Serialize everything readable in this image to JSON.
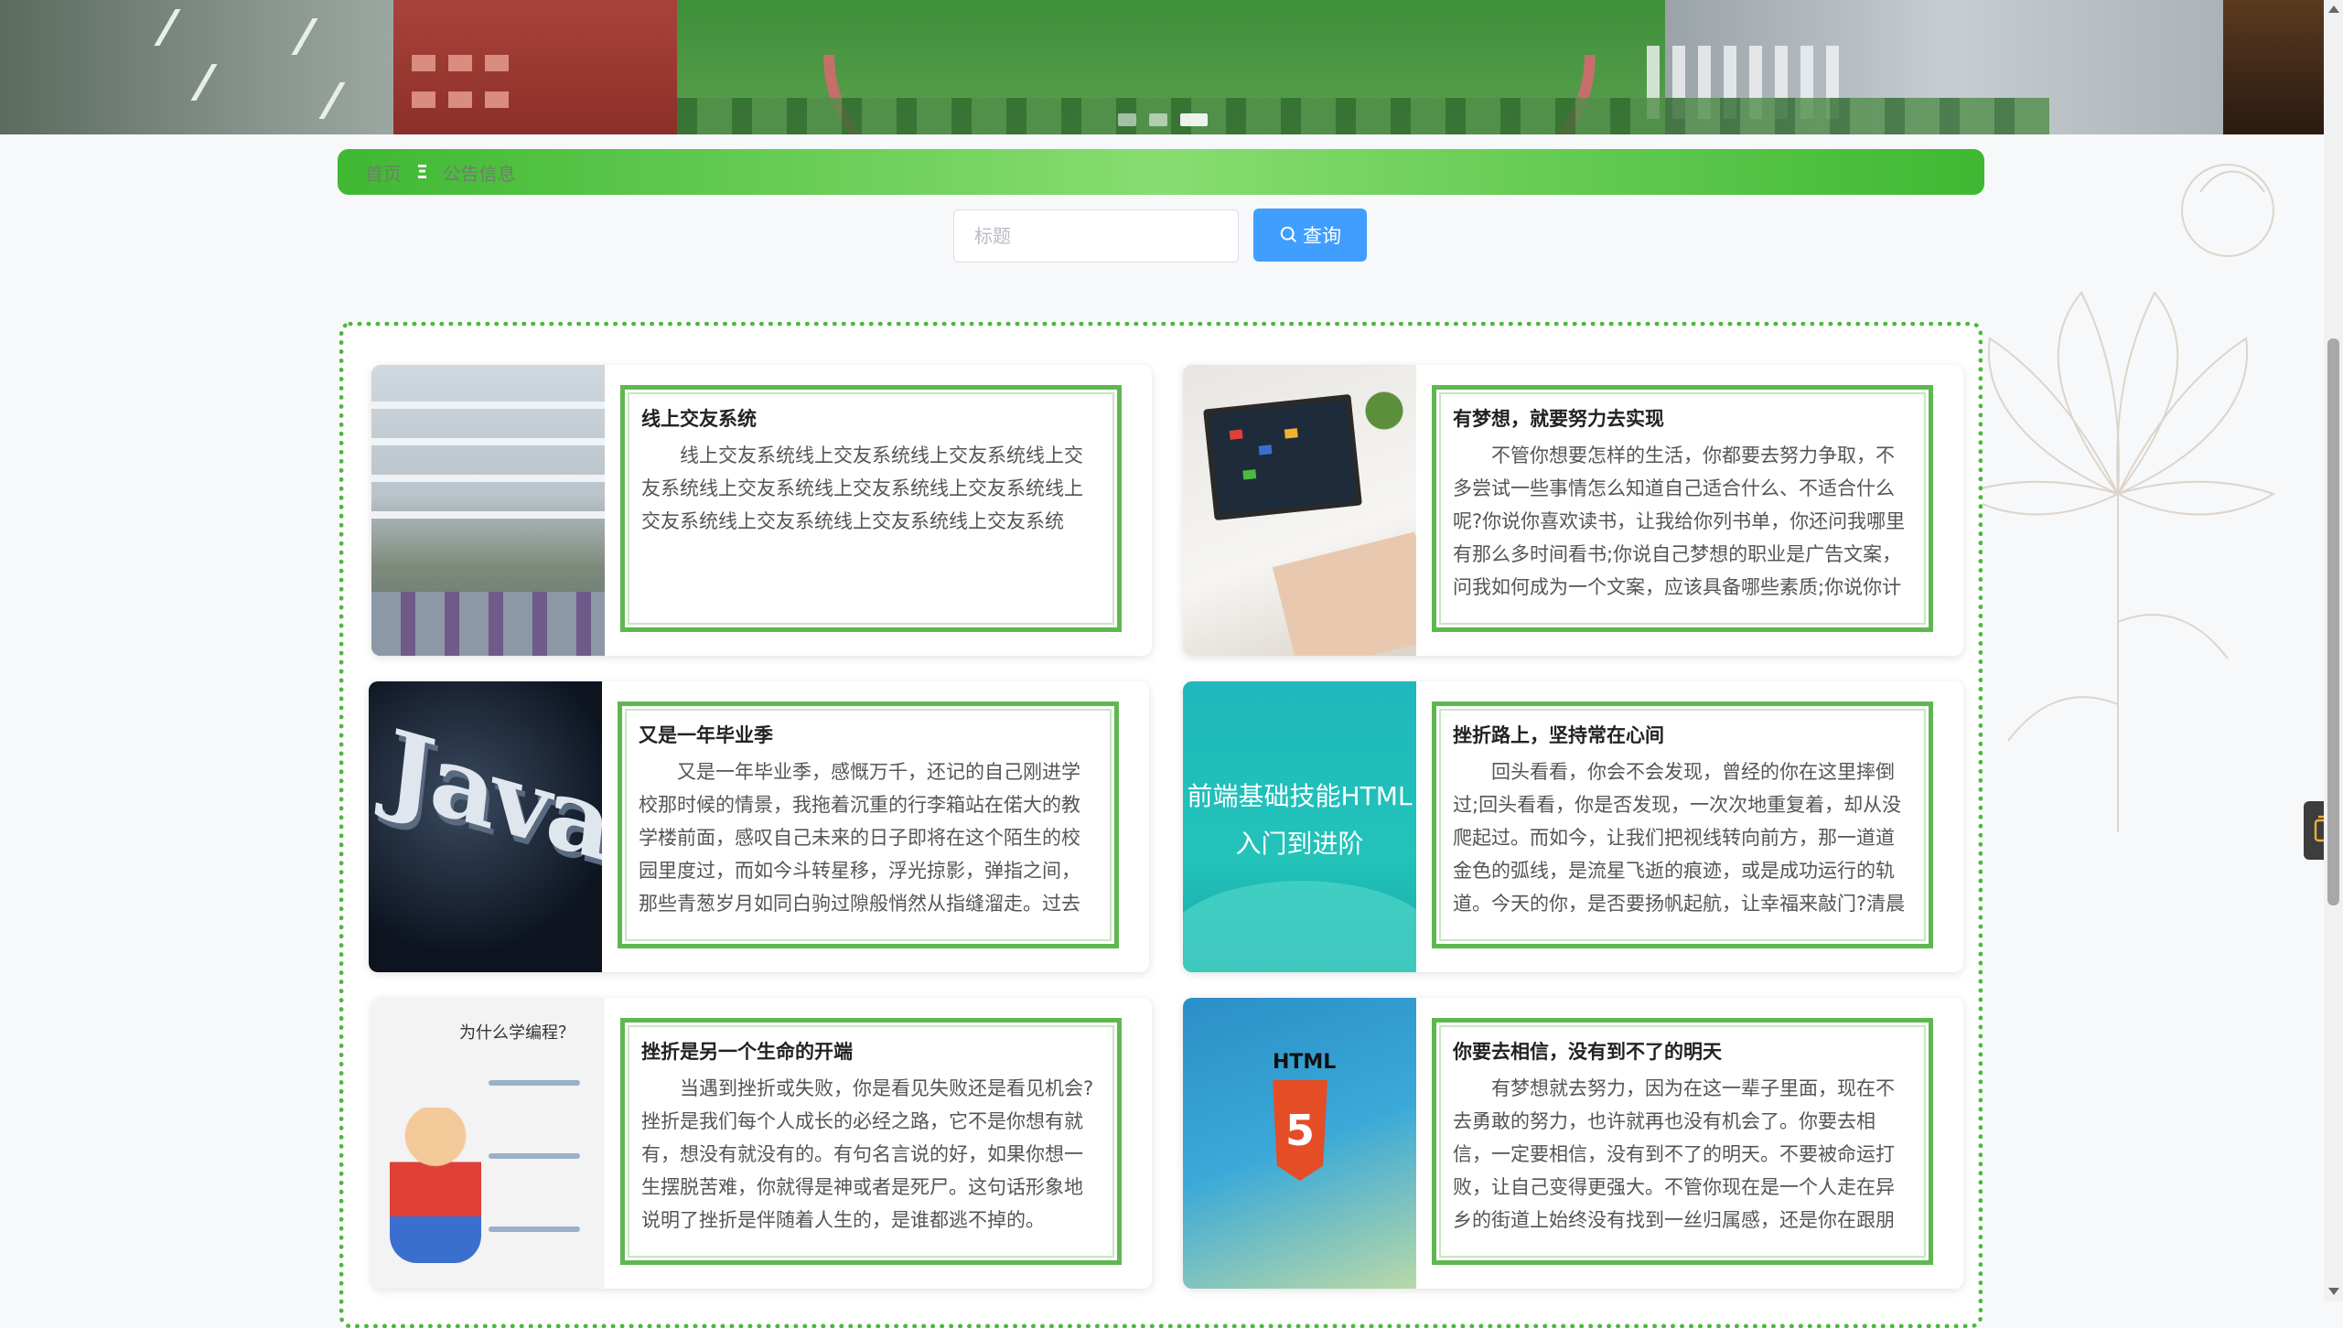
{
  "breadcrumb": {
    "home": "首页",
    "separator": "Ξ",
    "current": "公告信息"
  },
  "search": {
    "placeholder": "标题",
    "button_label": "查询"
  },
  "banner": {
    "slides": 3,
    "active_slide": 3
  },
  "colors": {
    "green": "#4cb840",
    "blue": "#409eff"
  },
  "thumb_texts": {
    "java": "Java",
    "html_line1": "前端基础技能HTML",
    "html_line2": "入门到进阶",
    "cartoon_heading": "为什么学编程？",
    "html5_label": "HTML",
    "html5_glyph": "5"
  },
  "notices": [
    {
      "title": "线上交友系统",
      "content": "线上交友系统线上交友系统线上交友系统线上交友系统线上交友系统线上交友系统线上交友系统线上交友系统线上交友系统线上交友系统线上交友系统",
      "image": "campus-building"
    },
    {
      "title": "有梦想，就要努力去实现",
      "content": "不管你想要怎样的生活，你都要去努力争取，不多尝试一些事情怎么知道自己适合什么、不适合什么呢?你说你喜欢读书，让我给你列书单，你还问我哪里有那么多时间看书;你说自己梦想的职业是广告文案，问我如何成为一个文案，应该具备哪些素质;你说你计",
      "image": "laptop-desk"
    },
    {
      "title": "又是一年毕业季",
      "content": "又是一年毕业季，感慨万千，还记的自己刚进学校那时候的情景，我拖着沉重的行李箱站在偌大的教学楼前面，感叹自己未来的日子即将在这个陌生的校园里度过，而如今斗转星移，浮光掠影，弹指之间，那些青葱岁月如同白驹过隙般悄然从指缝溜走。过去",
      "image": "java"
    },
    {
      "title": "挫折路上，坚持常在心间",
      "content": "回头看看，你会不会发现，曾经的你在这里摔倒过;回头看看，你是否发现，一次次地重复着，却从没爬起过。而如今，让我们把视线转向前方，那一道道金色的弧线，是流星飞逝的痕迹，或是成功运行的轨道。今天的你，是否要扬帆起航，让幸福来敲门?清晨",
      "image": "html-course"
    },
    {
      "title": "挫折是另一个生命的开端",
      "content": "当遇到挫折或失败，你是看见失败还是看见机会?挫折是我们每个人成长的必经之路，它不是你想有就有，想没有就没有的。有句名言说的好，如果你想一生摆脱苦难，你就得是神或者是死尸。这句话形象地说明了挫折是伴随着人生的，是谁都逃不掉的。",
      "image": "cartoon-programming"
    },
    {
      "title": "你要去相信，没有到不了的明天",
      "content": "有梦想就去努力，因为在这一辈子里面，现在不去勇敢的努力，也许就再也没有机会了。你要去相信，一定要相信，没有到不了的明天。不要被命运打败，让自己变得更强大。不管你现在是一个人走在异乡的街道上始终没有找到一丝归属感，还是你在跟朋",
      "image": "html5"
    }
  ]
}
